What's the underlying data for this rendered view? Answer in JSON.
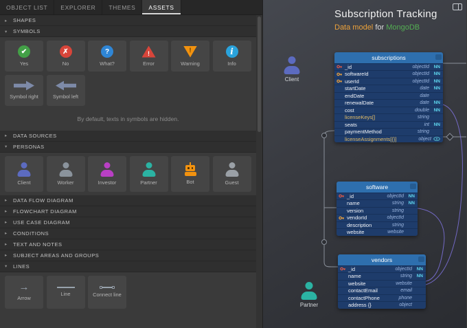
{
  "tabs": [
    "OBJECT LIST",
    "EXPLORER",
    "THEMES",
    "ASSETS"
  ],
  "active_tab": "ASSETS",
  "panel": {
    "sections": [
      {
        "label": "SHAPES",
        "expanded": false
      },
      {
        "label": "SYMBOLS",
        "expanded": true,
        "tiles": [
          {
            "label": "Yes",
            "icon": "check-circle-icon",
            "color": "#43a047"
          },
          {
            "label": "No",
            "icon": "cross-circle-icon",
            "color": "#d8453a"
          },
          {
            "label": "What?",
            "icon": "question-circle-icon",
            "color": "#2f86d6"
          },
          {
            "label": "Error",
            "icon": "error-triangle-icon",
            "color": "#d8453a"
          },
          {
            "label": "Warning",
            "icon": "warning-triangle-icon",
            "color": "#f2920f"
          },
          {
            "label": "Info",
            "icon": "info-circle-icon",
            "color": "#2aa3dc"
          },
          {
            "label": "Symbol right",
            "icon": "arrow-right-symbol-icon",
            "color": "#7d8aa8"
          },
          {
            "label": "Symbol left",
            "icon": "arrow-left-symbol-icon",
            "color": "#7d8aa8"
          }
        ],
        "note": "By default, texts in symbols are hidden."
      },
      {
        "label": "DATA SOURCES",
        "expanded": false
      },
      {
        "label": "PERSONAS",
        "expanded": true,
        "tiles": [
          {
            "label": "Client",
            "icon": "persona-bust-icon",
            "color": "#5c6bc0"
          },
          {
            "label": "Worker",
            "icon": "persona-bust-icon",
            "color": "#8a939c"
          },
          {
            "label": "Investor",
            "icon": "persona-bust-icon",
            "color": "#b93fc4"
          },
          {
            "label": "Partner",
            "icon": "persona-bust-icon",
            "color": "#2bb3a3"
          },
          {
            "label": "Bot",
            "icon": "robot-icon",
            "color": "#f2920f"
          },
          {
            "label": "Guest",
            "icon": "persona-bust-icon",
            "color": "#9aa0a6"
          }
        ]
      },
      {
        "label": "DATA FLOW DIAGRAM",
        "expanded": false
      },
      {
        "label": "FLOWCHART DIAGRAM",
        "expanded": false
      },
      {
        "label": "USE CASE DIAGRAM",
        "expanded": false
      },
      {
        "label": "CONDITIONS",
        "expanded": false
      },
      {
        "label": "TEXT AND NOTES",
        "expanded": false
      },
      {
        "label": "SUBJECT AREAS AND GROUPS",
        "expanded": false
      },
      {
        "label": "LINES",
        "expanded": true,
        "tiles": [
          {
            "label": "Arrow",
            "icon": "arrow-line-icon"
          },
          {
            "label": "Line",
            "icon": "plain-line-icon"
          },
          {
            "label": "Connect line",
            "icon": "connect-line-icon"
          }
        ]
      }
    ]
  },
  "canvas": {
    "title": "Subscription Tracking",
    "subtitle": {
      "lead": "Data model ",
      "mid": "for ",
      "brand": "MongoDB"
    },
    "colors": {
      "subtitle_lead": "#eda23b",
      "subtitle_brand": "#53ae53",
      "entity_header": "#2e6fae",
      "entity_body": "#1e3c6b",
      "nn_flag": "#5fd7ee",
      "primary_key": "#e05a47",
      "foreign_key": "#f0a33c",
      "connector_gray": "#8a909a",
      "connector_purple": "#7a6fd4"
    },
    "personas": [
      {
        "name": "Client",
        "color": "#5c6bc0"
      },
      {
        "name": "Partner",
        "color": "#2bb3a3"
      }
    ],
    "entities": [
      {
        "name": "subscriptions",
        "fields": [
          {
            "name": "_id",
            "type": "objectId",
            "nn": "NN",
            "icon": "key-primary"
          },
          {
            "name": "softwareId",
            "type": "objectId",
            "nn": "NN",
            "icon": "key"
          },
          {
            "name": "userId",
            "type": "objectId",
            "nn": "NN",
            "icon": "key"
          },
          {
            "name": "startDate",
            "type": "date",
            "nn": "NN"
          },
          {
            "name": "endDate",
            "type": "date"
          },
          {
            "name": "renewalDate",
            "type": "date",
            "nn": "NN"
          },
          {
            "name": "cost",
            "type": "double",
            "nn": "NN"
          },
          {
            "name": "licenseKeys[]",
            "type": "string",
            "accent": true
          },
          {
            "name": "seats",
            "type": "int",
            "nn": "NN"
          },
          {
            "name": "paymentMethod",
            "type": "string"
          },
          {
            "name": "licenseAssignments[{}]",
            "type": "object",
            "accent": true,
            "icon_right": "eye"
          }
        ]
      },
      {
        "name": "software",
        "fields": [
          {
            "name": "_id",
            "type": "objectId",
            "nn": "NN",
            "icon": "key-primary"
          },
          {
            "name": "name",
            "type": "string",
            "nn": "NN"
          },
          {
            "name": "version",
            "type": "string"
          },
          {
            "name": "vendorId",
            "type": "objectId",
            "icon": "key"
          },
          {
            "name": "description",
            "type": "string"
          },
          {
            "name": "website",
            "type": "website"
          }
        ]
      },
      {
        "name": "vendors",
        "fields": [
          {
            "name": "_id",
            "type": "objectId",
            "nn": "NN",
            "icon": "key-primary"
          },
          {
            "name": "name",
            "type": "string",
            "nn": "NN"
          },
          {
            "name": "website",
            "type": "website"
          },
          {
            "name": "contactEmail",
            "type": "email"
          },
          {
            "name": "contactPhone",
            "type": "phone"
          },
          {
            "name": "address {}",
            "type": "object"
          }
        ]
      }
    ]
  }
}
